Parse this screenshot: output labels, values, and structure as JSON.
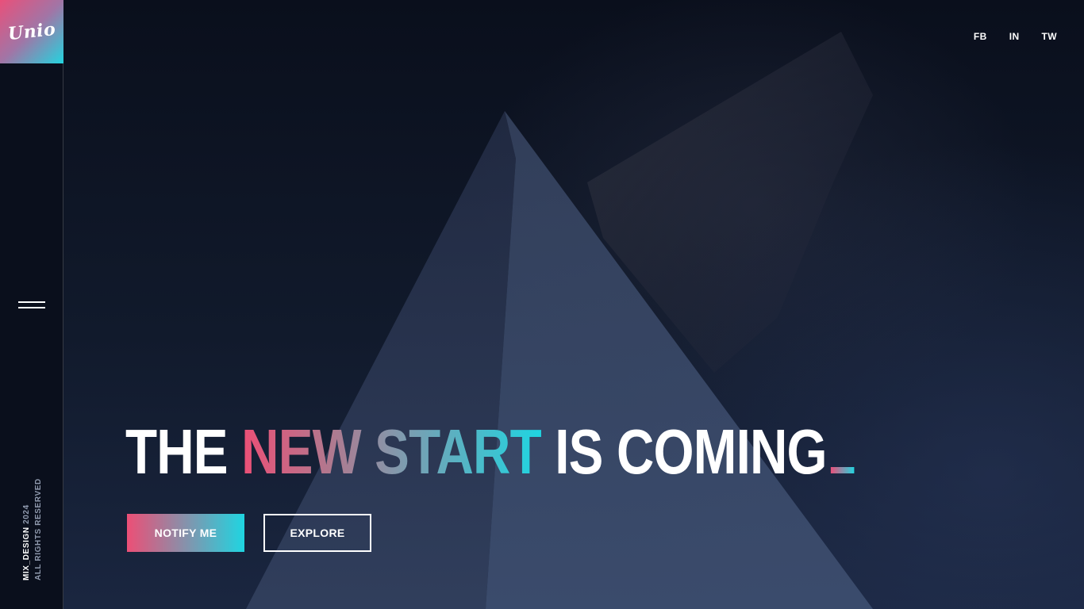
{
  "logo": {
    "text": "Unio"
  },
  "sidebar": {
    "menu_icon": "hamburger-menu-icon",
    "copyright_brand": "MIX_DESIGN",
    "copyright_year": "2024",
    "rights": "ALL RIGHTS RESERVED"
  },
  "social": {
    "facebook": "FB",
    "instagram": "IN",
    "twitter": "TW"
  },
  "hero": {
    "word1": "THE",
    "word2": "NEW START",
    "word3": "IS COMING",
    "cursor": "_"
  },
  "buttons": {
    "notify": "NOTIFY ME",
    "explore": "EXPLORE"
  },
  "colors": {
    "accent_pink": "#ec4f76",
    "accent_cyan": "#1fd5e1",
    "background": "#0b1120"
  }
}
